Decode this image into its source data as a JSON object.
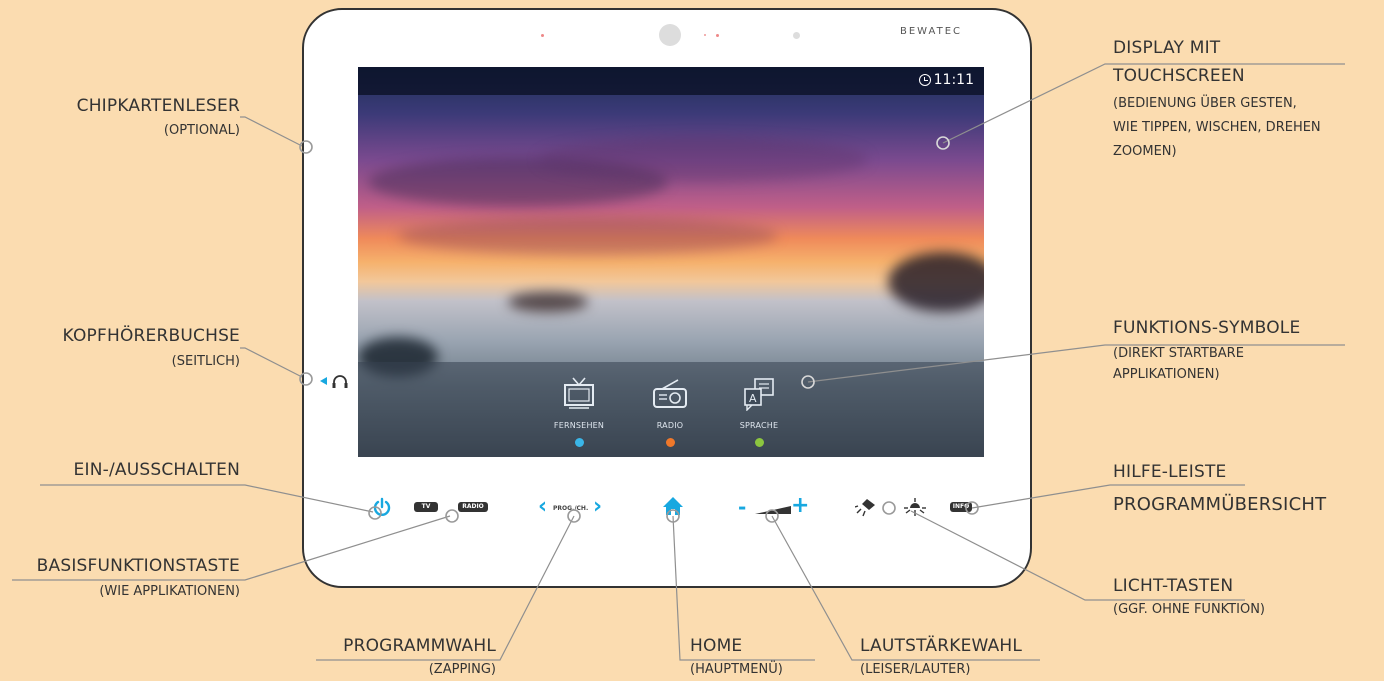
{
  "device": {
    "brand": "BEWATEC",
    "clock": "11:11",
    "apps": [
      {
        "label": "FERNSEHEN",
        "dot_color": "#3ab6e8"
      },
      {
        "label": "RADIO",
        "dot_color": "#f0782a"
      },
      {
        "label": "SPRACHE",
        "dot_color": "#8cc63f"
      }
    ],
    "buttons": {
      "tv": "TV",
      "radio": "RADIO",
      "prog": "PROG./CH.",
      "info": "INFO",
      "minus": "-",
      "plus": "+",
      "prev": "‹",
      "next": "›"
    },
    "colors": {
      "accent": "#18a8e0",
      "background": "#fbdcb0",
      "line": "#8f8f8f"
    },
    "icons": [
      "power-icon",
      "home-icon",
      "headphone-icon",
      "tv-icon",
      "radio-icon",
      "language-icon",
      "reading-light-icon",
      "room-light-icon",
      "clock-icon"
    ]
  },
  "callouts": {
    "chipkartenleser": {
      "title": "CHIPKARTENLESER",
      "sub": "(OPTIONAL)"
    },
    "kopfhoerer": {
      "title": "KOPFHÖRERBUCHSE",
      "sub": "(SEITLICH)"
    },
    "ein_aus": {
      "title": "EIN-/AUSSCHALTEN"
    },
    "basisfunktion": {
      "title": "BASISFUNKTIONSTASTE",
      "sub": "(WIE APPLIKATIONEN)"
    },
    "programmwahl": {
      "title": "PROGRAMMWAHL",
      "sub": "(ZAPPING)"
    },
    "home": {
      "title": "HOME",
      "sub": "(HAUPTMENÜ)"
    },
    "lautstaerke": {
      "title": "LAUTSTÄRKEWAHL",
      "sub": "(LEISER/LAUTER)"
    },
    "licht": {
      "title": "LICHT-TASTEN",
      "sub": "(GGF. OHNE FUNKTION)"
    },
    "hilfe": {
      "title_line1": "HILFE-LEISTE",
      "title_line2": "PROGRAMMÜBERSICHT"
    },
    "funktion": {
      "title": "FUNKTIONS-SYMBOLE",
      "sub_line1": "(DIREKT STARTBARE",
      "sub_line2": "APPLIKATIONEN)"
    },
    "display": {
      "title_line1": "DISPLAY MIT",
      "title_line2": "TOUCHSCREEN",
      "sub_line1": "(BEDIENUNG ÜBER GESTEN,",
      "sub_line2": "WIE TIPPEN, WISCHEN, DREHEN",
      "sub_line3": "ZOOMEN)"
    }
  }
}
